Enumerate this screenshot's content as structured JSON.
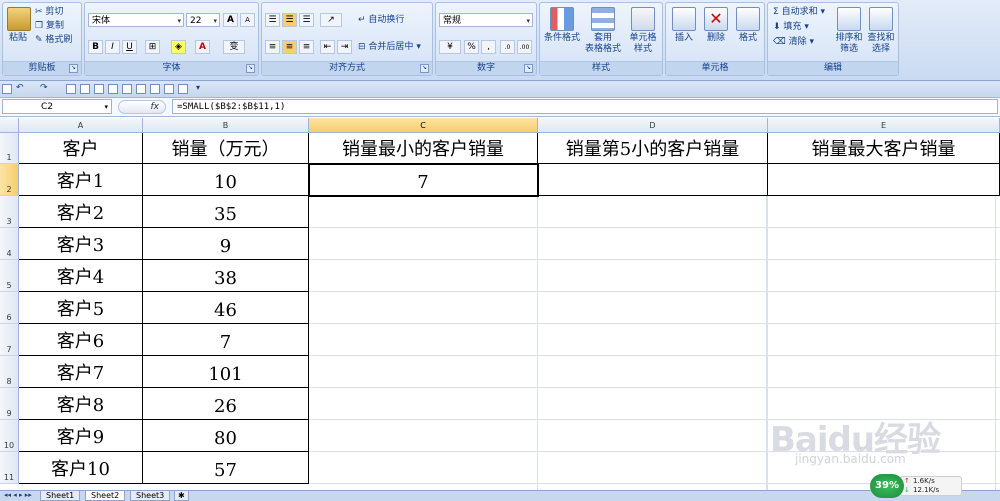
{
  "ribbon": {
    "clipboard": {
      "group_label": "剪贴板",
      "paste": "粘贴",
      "cut": "剪切",
      "copy": "复制",
      "format_painter": "格式刷"
    },
    "font": {
      "group_label": "字体",
      "font_name": "宋体",
      "font_size": "22",
      "grow": "A",
      "shrink": "A",
      "bold": "B",
      "italic": "I",
      "underline": "U",
      "wen": "变"
    },
    "alignment": {
      "group_label": "对齐方式",
      "wrap_text": "自动换行",
      "merge_center": "合并后居中"
    },
    "number": {
      "group_label": "数字",
      "format": "常规",
      "percent": "%",
      "comma": ","
    },
    "styles": {
      "group_label": "样式",
      "conditional": "条件格式",
      "table_1": "套用",
      "table_2": "表格格式",
      "cell_style_1": "单元格",
      "cell_style_2": "样式"
    },
    "cells": {
      "group_label": "单元格",
      "insert": "插入",
      "delete": "删除",
      "format": "格式"
    },
    "editing": {
      "group_label": "编辑",
      "autosum": "自动求和",
      "fill": "填充",
      "clear": "清除",
      "sort_1": "排序和",
      "sort_2": "筛选",
      "find_1": "查找和",
      "find_2": "选择"
    }
  },
  "formula_bar": {
    "name_box": "C2",
    "fx": "fx",
    "formula": "=SMALL($B$2:$B$11,1)"
  },
  "columns": [
    "A",
    "B",
    "C",
    "D",
    "E"
  ],
  "rows": [
    "1",
    "2",
    "3",
    "4",
    "5",
    "6",
    "7",
    "8",
    "9",
    "10",
    "11"
  ],
  "header_row": {
    "a": "客户",
    "b": "销量（万元）",
    "c": "销量最小的客户销量",
    "d": "销量第5小的客户销量",
    "e": "销量最大客户销量"
  },
  "customers": [
    {
      "name": "客户1",
      "sales": "10"
    },
    {
      "name": "客户2",
      "sales": "35"
    },
    {
      "name": "客户3",
      "sales": "9"
    },
    {
      "name": "客户4",
      "sales": "38"
    },
    {
      "name": "客户5",
      "sales": "46"
    },
    {
      "name": "客户6",
      "sales": "7"
    },
    {
      "name": "客户7",
      "sales": "101"
    },
    {
      "name": "客户8",
      "sales": "26"
    },
    {
      "name": "客户9",
      "sales": "80"
    },
    {
      "name": "客户10",
      "sales": "57"
    }
  ],
  "results": {
    "c2": "7"
  },
  "sheets": [
    "Sheet1",
    "Sheet2",
    "Sheet3"
  ],
  "active_sheet": "Sheet2",
  "watermark": {
    "main": "Baidu经验",
    "sub": "jingyan.baidu.com"
  },
  "speed_widget": {
    "percent": "39%",
    "upload": "1.6K/s",
    "download": "12.1K/s"
  },
  "colors": {
    "accent": "#15428b",
    "selected_header": "#f8cd6c",
    "speed_green": "#1d8a3a"
  }
}
